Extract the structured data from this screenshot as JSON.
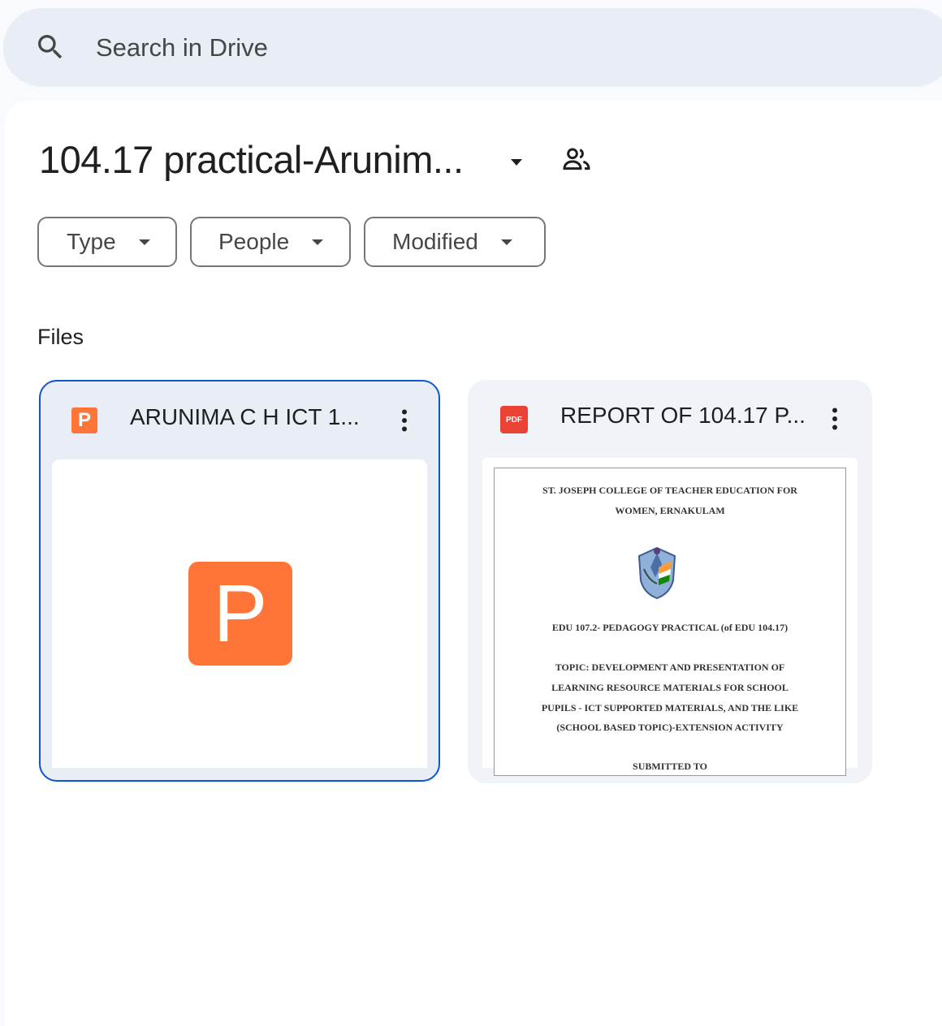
{
  "search": {
    "placeholder": "Search in Drive"
  },
  "header": {
    "title": "104.17 practical-Arunim..."
  },
  "filters": {
    "type_label": "Type",
    "people_label": "People",
    "modified_label": "Modified"
  },
  "files_section": {
    "label": "Files",
    "items": [
      {
        "name": "ARUNIMA C H ICT 1...",
        "file_type": "ppt",
        "icon_letter": "P",
        "selected": true
      },
      {
        "name": "REPORT OF 104.17 P...",
        "file_type": "pdf",
        "icon_text": "PDF",
        "preview_lines": [
          "ST. JOSEPH COLLEGE OF TEACHER EDUCATION FOR",
          "WOMEN, ERNAKULAM",
          "EDU 107.2- PEDAGOGY PRACTICAL (of EDU 104.17)",
          "TOPIC: DEVELOPMENT AND PRESENTATION OF",
          "LEARNING RESOURCE MATERIALS FOR SCHOOL",
          "PUPILS - ICT SUPPORTED MATERIALS, AND THE LIKE",
          "(SCHOOL BASED TOPIC)-EXTENSION ACTIVITY",
          "SUBMITTED TO"
        ]
      }
    ]
  },
  "colors": {
    "ppt_orange": "#ff7538",
    "pdf_red": "#ea4335",
    "selected_border": "#0b57d0"
  }
}
